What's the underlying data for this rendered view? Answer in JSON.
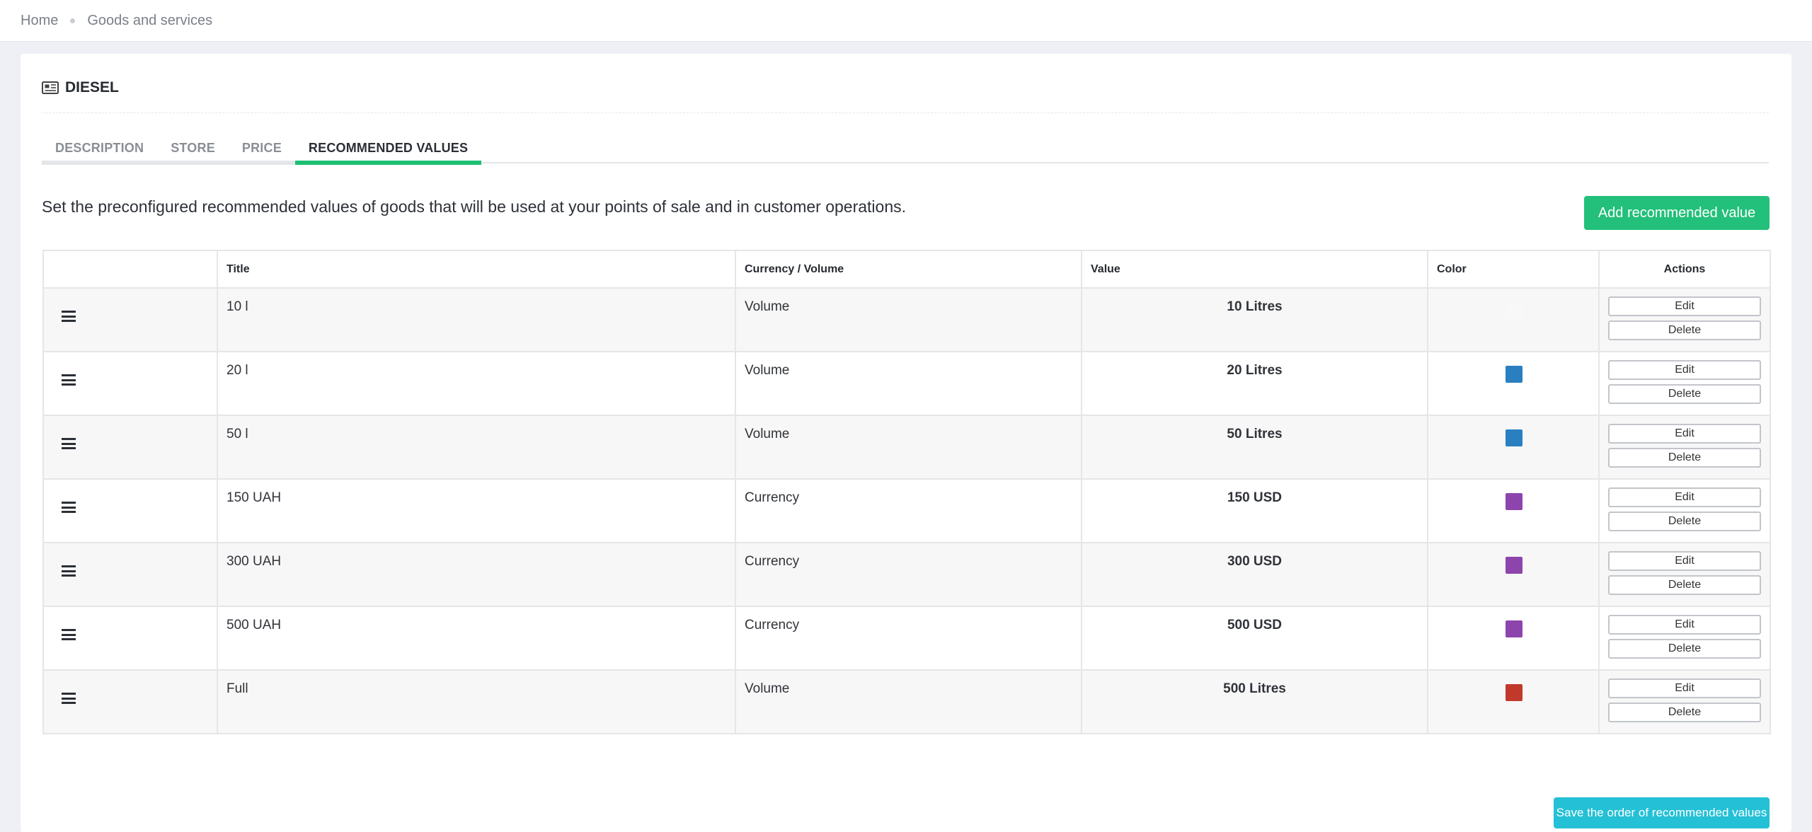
{
  "breadcrumb": {
    "home": "Home",
    "current": "Goods and services"
  },
  "card": {
    "title": "DIESEL",
    "title_icon": "newspaper-icon"
  },
  "tabs": [
    {
      "label": "DESCRIPTION",
      "active": false
    },
    {
      "label": "STORE",
      "active": false
    },
    {
      "label": "PRICE",
      "active": false
    },
    {
      "label": "RECOMMENDED VALUES",
      "active": true
    }
  ],
  "intro_text": "Set the preconfigured recommended values of goods that will be used at your points of sale and in customer operations.",
  "add_button": "Add recommended value",
  "table": {
    "headers": {
      "title": "Title",
      "type": "Currency / Volume",
      "value": "Value",
      "color": "Color",
      "actions": "Actions"
    },
    "edit_label": "Edit",
    "delete_label": "Delete",
    "rows": [
      {
        "title": "10 l",
        "type": "Volume",
        "value": "10 Litres",
        "color": "#f8f8f8"
      },
      {
        "title": "20 l",
        "type": "Volume",
        "value": "20 Litres",
        "color": "#2a7fc1"
      },
      {
        "title": "50 l",
        "type": "Volume",
        "value": "50 Litres",
        "color": "#2a7fc1"
      },
      {
        "title": "150 UAH",
        "type": "Currency",
        "value": "150 USD",
        "color": "#8e44ad"
      },
      {
        "title": "300 UAH",
        "type": "Currency",
        "value": "300 USD",
        "color": "#8e44ad"
      },
      {
        "title": "500 UAH",
        "type": "Currency",
        "value": "500 USD",
        "color": "#8e44ad"
      },
      {
        "title": "Full",
        "type": "Volume",
        "value": "500 Litres",
        "color": "#c0392b"
      }
    ]
  },
  "save_button": "Save the order of recommended values",
  "colors": {
    "accent_green": "#22c07a",
    "accent_cyan": "#24c0d6"
  }
}
